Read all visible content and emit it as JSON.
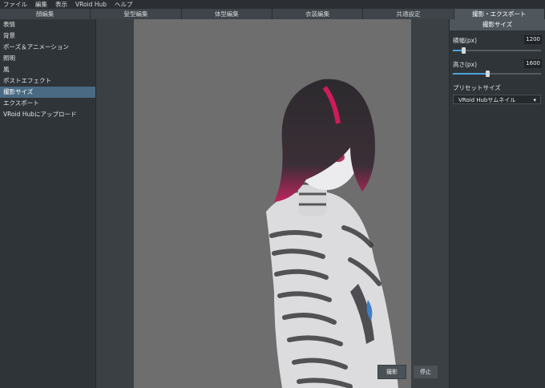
{
  "menu": [
    "ファイル",
    "編集",
    "表示",
    "VRoid Hub",
    "ヘルプ"
  ],
  "tabs": [
    "顔編集",
    "髪型編集",
    "体型編集",
    "衣装編集",
    "共通設定",
    "撮影・エクスポート"
  ],
  "active_tab_index": 5,
  "sidebar": {
    "items": [
      "表情",
      "背景",
      "ポーズ＆アニメーション",
      "照明",
      "風",
      "ポストエフェクト",
      "撮影サイズ",
      "エクスポート",
      "VRoid Hubにアップロード"
    ],
    "selected_index": 6
  },
  "panel": {
    "title": "撮影サイズ",
    "width_label": "横幅(px)",
    "width_value": "1200",
    "width_fraction": 0.12,
    "height_label": "高さ(px)",
    "height_value": "1600",
    "height_fraction": 0.39,
    "preset_label": "プリセットサイズ",
    "preset_value": "VRoid Hubサムネイル"
  },
  "buttons": {
    "shoot": "撮影",
    "stop": "停止"
  },
  "colors": {
    "accent": "#4aa3df",
    "selection": "#4a6a83",
    "canvas": "#6e6e6e"
  }
}
